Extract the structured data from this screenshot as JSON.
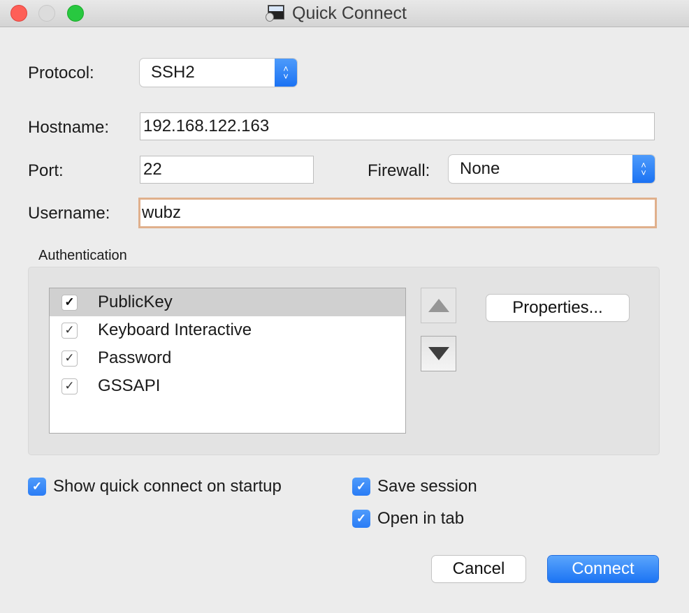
{
  "window": {
    "title": "Quick Connect",
    "app_icon": "securecrt-terminal-icon"
  },
  "form": {
    "protocol": {
      "label": "Protocol:",
      "value": "SSH2"
    },
    "hostname": {
      "label": "Hostname:",
      "value": "192.168.122.163"
    },
    "port": {
      "label": "Port:",
      "value": "22"
    },
    "firewall": {
      "label": "Firewall:",
      "value": "None"
    },
    "username": {
      "label": "Username:",
      "value": "wubz"
    }
  },
  "authentication": {
    "label": "Authentication",
    "methods": [
      {
        "label": "PublicKey",
        "checked": true,
        "selected": true
      },
      {
        "label": "Keyboard Interactive",
        "checked": true,
        "selected": false
      },
      {
        "label": "Password",
        "checked": true,
        "selected": false
      },
      {
        "label": "GSSAPI",
        "checked": true,
        "selected": false
      }
    ],
    "move_up_icon": "triangle-up-icon",
    "move_down_icon": "triangle-down-icon",
    "properties_label": "Properties..."
  },
  "options": {
    "show_on_startup": {
      "label": "Show quick connect on startup",
      "checked": true
    },
    "save_session": {
      "label": "Save session",
      "checked": true
    },
    "open_in_tab": {
      "label": "Open in tab",
      "checked": true
    }
  },
  "buttons": {
    "cancel": "Cancel",
    "connect": "Connect"
  },
  "colors": {
    "accent": "#1c74f4",
    "focus_ring": "#e0b08c",
    "close": "#fe5f57",
    "maximize": "#28c840"
  },
  "glyphs": {
    "check": "✓",
    "chevron_up": "⌃",
    "chevron_down": "⌄"
  }
}
